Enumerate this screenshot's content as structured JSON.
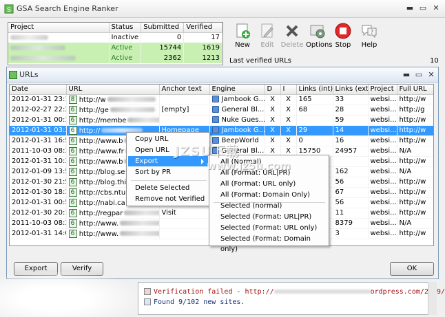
{
  "app": {
    "title": "GSA Search Engine Ranker"
  },
  "projects": {
    "headers": [
      "Project",
      "Status",
      "Submitted",
      "Verified"
    ],
    "rows": [
      {
        "status": "Inactive",
        "submitted": "0",
        "verified": "17"
      },
      {
        "status": "Active",
        "submitted": "15744",
        "verified": "1619"
      },
      {
        "status": "Active",
        "submitted": "2362",
        "verified": "1213"
      }
    ]
  },
  "toolbar": {
    "new": "New",
    "edit": "Edit",
    "delete": "Delete",
    "options": "Options",
    "stop": "Stop",
    "help": "Help"
  },
  "last_verified": {
    "label": "Last verified URLs",
    "count": "10"
  },
  "urls_window": {
    "title": "URLs",
    "headers": [
      "Date",
      "URL",
      "Anchor text",
      "Engine",
      "D",
      "I",
      "Links (int)",
      "Links (ext)",
      "Project",
      "Full URL"
    ],
    "rows": [
      {
        "date": "2012-01-31 23:12",
        "pr": "8",
        "url": "http://w",
        "anchor": "",
        "engine": "Jambook G...",
        "d": "X",
        "i": "X",
        "lint": "165",
        "lext": "33",
        "project": "websi...",
        "full": "http://w"
      },
      {
        "date": "2012-02-27 22:25",
        "pr": "6",
        "url": "http://ge",
        "anchor": "[empty]",
        "engine": "General Bl...",
        "d": "X",
        "i": "X",
        "lint": "68",
        "lext": "28",
        "project": "websi...",
        "full": "http://g"
      },
      {
        "date": "2012-01-31 00:36",
        "pr": "6",
        "url": "http://membe",
        "anchor": "",
        "engine": "Nuke Gues...",
        "d": "X",
        "i": "X",
        "lint": "",
        "lext": "59",
        "project": "websi...",
        "full": "http://w"
      },
      {
        "date": "2012-01-31 03:23",
        "pr": "6",
        "url": "http://",
        "anchor": "Homepage",
        "engine": "Jambook G...",
        "d": "X",
        "i": "X",
        "lint": "29",
        "lext": "14",
        "project": "websi...",
        "full": "http://w"
      },
      {
        "date": "2012-01-31 16:59",
        "pr": "6",
        "url": "http://www.b",
        "anchor": "",
        "engine": "BeepWorld",
        "d": "X",
        "i": "X",
        "lint": "0",
        "lext": "16",
        "project": "websi...",
        "full": "http://w"
      },
      {
        "date": "2011-10-03 08:34",
        "pr": "6",
        "url": "http://www.fr",
        "anchor": "",
        "engine": "General Bl...",
        "d": "X",
        "i": "X",
        "lint": "15750",
        "lext": "24957",
        "project": "websi...",
        "full": "N/A"
      },
      {
        "date": "2012-01-31 10:33",
        "pr": "6",
        "url": "http://www.b",
        "anchor": "",
        "engine": "",
        "d": "",
        "i": "",
        "lint": "",
        "lext": "",
        "project": "websi...",
        "full": "http://w"
      },
      {
        "date": "2012-01-09 13:58",
        "pr": "6",
        "url": "http://blog.se",
        "anchor": "",
        "engine": "",
        "d": "",
        "i": "",
        "lint": "",
        "lext": "162",
        "project": "websi...",
        "full": "N/A"
      },
      {
        "date": "2012-01-30 21:54",
        "pr": "6",
        "url": "http://blog.thi",
        "anchor": "",
        "engine": "",
        "d": "",
        "i": "",
        "lint": "",
        "lext": "56",
        "project": "websi...",
        "full": "http://w"
      },
      {
        "date": "2012-01-30 18:35",
        "pr": "6",
        "url": "http://cbs.ntu",
        "anchor": "",
        "engine": "",
        "d": "",
        "i": "",
        "lint": "",
        "lext": "67",
        "project": "websi...",
        "full": "http://w"
      },
      {
        "date": "2012-01-31 00:56",
        "pr": "6",
        "url": "http://nabi.ca",
        "anchor": "",
        "engine": "",
        "d": "",
        "i": "",
        "lint": "",
        "lext": "56",
        "project": "websi...",
        "full": "http://w"
      },
      {
        "date": "2012-01-30 20:10",
        "pr": "6",
        "url": "http://regpar",
        "anchor": "Visit",
        "engine": "",
        "d": "",
        "i": "",
        "lint": "",
        "lext": "11",
        "project": "websi...",
        "full": "http://w"
      },
      {
        "date": "2011-10-03 08:37",
        "pr": "6",
        "url": "http://www.",
        "anchor": "",
        "engine": "",
        "d": "",
        "i": "",
        "lint": "",
        "lext": "8379",
        "project": "websi...",
        "full": "N/A"
      },
      {
        "date": "2012-01-31 14:08",
        "pr": "6",
        "url": "http://www.",
        "anchor": "",
        "engine": "",
        "d": "",
        "i": "",
        "lint": "",
        "lext": "3",
        "project": "websi...",
        "full": "http://w"
      }
    ]
  },
  "context_menu": {
    "items": [
      "Copy URL",
      "Open URL",
      "Export",
      "Sort by PR",
      "Delete Selected",
      "Remove not Verified"
    ]
  },
  "export_submenu": {
    "items": [
      "All (Normal)",
      "All (Format: URL|PR)",
      "All (Format: URL only)",
      "All (Format: Domain Only)",
      "Selected (normal)",
      "Selected (Format: URL|PR)",
      "Selected (Format: URL only)",
      "Selected (Format: Domain only)"
    ]
  },
  "buttons": {
    "export": "Export",
    "verify": "Verify",
    "ok": "OK"
  },
  "log": {
    "line1_prefix": "Verification failed - http://",
    "line1_suffix": "ordpress.com/2009/0",
    "line2": "Found 9/102 new sites."
  },
  "watermark": {
    "line1": "JZSU下载",
    "line2": "www.jz5u.com"
  }
}
